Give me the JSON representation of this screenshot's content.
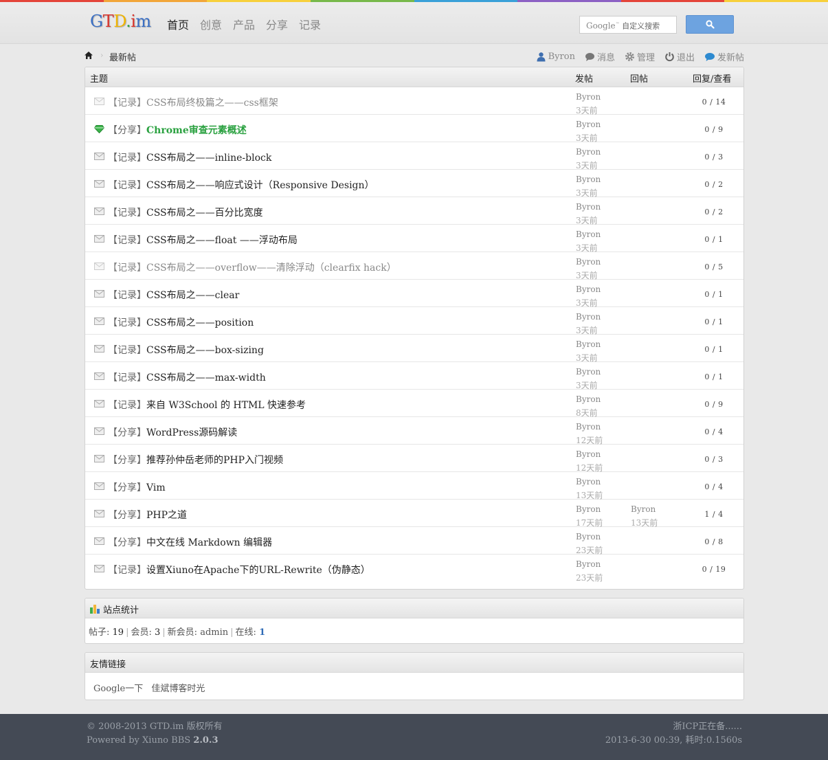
{
  "colors": {
    "rainbow": [
      "#e4443a",
      "#f2a63a",
      "#f7d03c",
      "#77b84a",
      "#3aa0d8",
      "#8c61c4",
      "#e4443a",
      "#f7d03c"
    ],
    "accent_green": "#2aa140",
    "search_button": "#6da3e0",
    "footer_bg": "#444a55"
  },
  "header": {
    "logo": [
      "G",
      "T",
      "D",
      ".",
      "i",
      "m"
    ],
    "nav": [
      {
        "label": "首页",
        "active": true
      },
      {
        "label": "创意",
        "active": false
      },
      {
        "label": "产品",
        "active": false
      },
      {
        "label": "分享",
        "active": false
      },
      {
        "label": "记录",
        "active": false
      }
    ],
    "search": {
      "brand": "Google",
      "tm": "™",
      "placeholder": "自定义搜索",
      "button_icon": "search-icon"
    }
  },
  "breadcrumb": {
    "home_icon": "home-icon",
    "current": "最新帖"
  },
  "userbar": [
    {
      "icon": "user-icon",
      "label": "Byron"
    },
    {
      "icon": "message-icon",
      "label": "消息"
    },
    {
      "icon": "gear-icon",
      "label": "管理"
    },
    {
      "icon": "power-icon",
      "label": "退出"
    },
    {
      "icon": "new-post-icon",
      "label": "发新帖"
    }
  ],
  "thread_list": {
    "columns": {
      "subject": "主题",
      "poster": "发帖",
      "reply": "回帖",
      "stats": "回复/查看"
    },
    "rows": [
      {
        "icon": "envelope-icon",
        "state": "read",
        "cat": "【记录】",
        "subject": "CSS布局终极篇之——css框架",
        "author": "Byron",
        "time": "3天前",
        "replier": "",
        "reply_time": "",
        "count": "0 / 14"
      },
      {
        "icon": "gem-icon",
        "state": "highlight",
        "cat": "【分享】",
        "subject": "Chrome审查元素概述",
        "author": "Byron",
        "time": "3天前",
        "replier": "",
        "reply_time": "",
        "count": "0 / 9"
      },
      {
        "icon": "envelope-icon",
        "state": "normal",
        "cat": "【记录】",
        "subject": "CSS布局之——inline-block",
        "author": "Byron",
        "time": "3天前",
        "replier": "",
        "reply_time": "",
        "count": "0 / 3"
      },
      {
        "icon": "envelope-icon",
        "state": "normal",
        "cat": "【记录】",
        "subject": "CSS布局之——响应式设计（Responsive Design）",
        "author": "Byron",
        "time": "3天前",
        "replier": "",
        "reply_time": "",
        "count": "0 / 2"
      },
      {
        "icon": "envelope-icon",
        "state": "normal",
        "cat": "【记录】",
        "subject": "CSS布局之——百分比宽度",
        "author": "Byron",
        "time": "3天前",
        "replier": "",
        "reply_time": "",
        "count": "0 / 2"
      },
      {
        "icon": "envelope-icon",
        "state": "normal",
        "cat": "【记录】",
        "subject": "CSS布局之——float ——浮动布局",
        "author": "Byron",
        "time": "3天前",
        "replier": "",
        "reply_time": "",
        "count": "0 / 1"
      },
      {
        "icon": "envelope-icon",
        "state": "read",
        "cat": "【记录】",
        "subject": "CSS布局之——overflow——清除浮动（clearfix hack）",
        "author": "Byron",
        "time": "3天前",
        "replier": "",
        "reply_time": "",
        "count": "0 / 5"
      },
      {
        "icon": "envelope-icon",
        "state": "normal",
        "cat": "【记录】",
        "subject": "CSS布局之——clear",
        "author": "Byron",
        "time": "3天前",
        "replier": "",
        "reply_time": "",
        "count": "0 / 1"
      },
      {
        "icon": "envelope-icon",
        "state": "normal",
        "cat": "【记录】",
        "subject": "CSS布局之——position",
        "author": "Byron",
        "time": "3天前",
        "replier": "",
        "reply_time": "",
        "count": "0 / 1"
      },
      {
        "icon": "envelope-icon",
        "state": "normal",
        "cat": "【记录】",
        "subject": "CSS布局之——box-sizing",
        "author": "Byron",
        "time": "3天前",
        "replier": "",
        "reply_time": "",
        "count": "0 / 1"
      },
      {
        "icon": "envelope-icon",
        "state": "normal",
        "cat": "【记录】",
        "subject": "CSS布局之——max-width",
        "author": "Byron",
        "time": "3天前",
        "replier": "",
        "reply_time": "",
        "count": "0 / 1"
      },
      {
        "icon": "envelope-icon",
        "state": "normal",
        "cat": "【记录】",
        "subject": "来自 W3School 的 HTML 快速参考",
        "author": "Byron",
        "time": "8天前",
        "replier": "",
        "reply_time": "",
        "count": "0 / 9"
      },
      {
        "icon": "envelope-icon",
        "state": "normal",
        "cat": "【分享】",
        "subject": "WordPress源码解读",
        "author": "Byron",
        "time": "12天前",
        "replier": "",
        "reply_time": "",
        "count": "0 / 4"
      },
      {
        "icon": "envelope-icon",
        "state": "normal",
        "cat": "【分享】",
        "subject": "推荐孙仲岳老师的PHP入门视频",
        "author": "Byron",
        "time": "12天前",
        "replier": "",
        "reply_time": "",
        "count": "0 / 3"
      },
      {
        "icon": "envelope-icon",
        "state": "normal",
        "cat": "【分享】",
        "subject": "Vim",
        "author": "Byron",
        "time": "13天前",
        "replier": "",
        "reply_time": "",
        "count": "0 / 4"
      },
      {
        "icon": "envelope-icon",
        "state": "normal",
        "cat": "【分享】",
        "subject": "PHP之道",
        "author": "Byron",
        "time": "17天前",
        "replier": "Byron",
        "reply_time": "13天前",
        "count": "1 / 4"
      },
      {
        "icon": "envelope-icon",
        "state": "normal",
        "cat": "【分享】",
        "subject": "中文在线 Markdown 编辑器",
        "author": "Byron",
        "time": "23天前",
        "replier": "",
        "reply_time": "",
        "count": "0 / 8"
      },
      {
        "icon": "envelope-icon",
        "state": "normal",
        "cat": "【记录】",
        "subject": "设置Xiuno在Apache下的URL-Rewrite（伪静态）",
        "author": "Byron",
        "time": "23天前",
        "replier": "",
        "reply_time": "",
        "count": "0 / 19"
      }
    ]
  },
  "stats": {
    "title": "站点统计",
    "icon": "bar-chart-icon",
    "posts_label": "帖子:",
    "posts": "19",
    "members_label": "会员:",
    "members": "3",
    "newest_label": "新会员:",
    "newest": "admin",
    "online_label": "在线:",
    "online": "1",
    "sep": "|"
  },
  "links": {
    "title": "友情链接",
    "items": [
      "Google一下",
      "佳斌博客时光"
    ]
  },
  "footer": {
    "copyright": "© 2008-2013 GTD.im 版权所有",
    "powered_prefix": "Powered by Xiuno BBS",
    "powered_version": "2.0.3",
    "icp": "浙ICP正在备......",
    "timing": "2013-6-30 00:39, 耗时:0.1560s"
  }
}
